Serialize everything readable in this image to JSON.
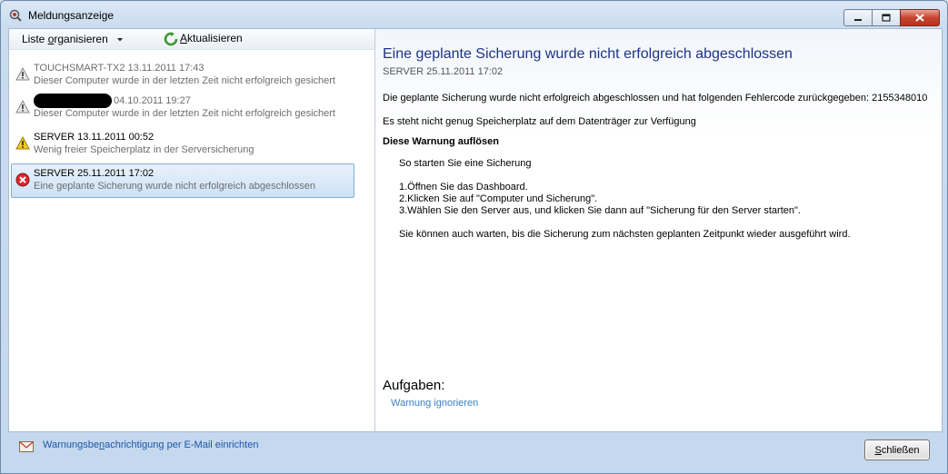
{
  "window": {
    "title": "Meldungsanzeige"
  },
  "toolbar": {
    "organize_pre": "Liste ",
    "organize_u": "o",
    "organize_post": "rganisieren",
    "refresh_u": "A",
    "refresh_post": "ktualisieren"
  },
  "alerts": [
    {
      "line1": "TOUCHSMART-TX2 13.11.2011 17:43",
      "line2": "Dieser Computer wurde in der letzten Zeit nicht erfolgreich gesichert",
      "severity": "info",
      "redacted": false
    },
    {
      "line1": "04.10.2011 19:27",
      "line2": "Dieser Computer wurde in der letzten Zeit nicht erfolgreich gesichert",
      "severity": "info",
      "redacted": true
    },
    {
      "line1": "SERVER 13.11.2011 00:52",
      "line2": "Wenig freier Speicherplatz in der Serversicherung",
      "severity": "warning",
      "redacted": false
    },
    {
      "line1": "SERVER 25.11.2011 17:02",
      "line2": "Eine geplante Sicherung wurde nicht erfolgreich abgeschlossen",
      "severity": "error",
      "redacted": false
    }
  ],
  "detail": {
    "title": "Eine geplante Sicherung wurde nicht erfolgreich abgeschlossen",
    "subtitle": "SERVER 25.11.2011 17:02",
    "para1": "Die geplante Sicherung wurde nicht erfolgreich abgeschlossen und hat folgenden Fehlercode zurückgegeben: 2155348010",
    "para2": "Es steht nicht genug Speicherplatz auf dem Datenträger zur Verfügung",
    "resolve_heading": "Diese Warnung auflösen",
    "howto": "So starten Sie eine Sicherung",
    "step1": "1.Öffnen Sie das Dashboard.",
    "step2": "2.Klicken Sie auf \"Computer und Sicherung\".",
    "step3": "3.Wählen Sie den Server aus, und klicken Sie dann auf \"Sicherung für den Server starten\".",
    "note": "Sie können auch warten, bis die Sicherung zum nächsten geplanten Zeitpunkt wieder ausgeführt wird.",
    "tasks_heading": "Aufgaben:",
    "task_ignore": "Warnung ignorieren"
  },
  "footer": {
    "mail_pre": "Warnungsbe",
    "mail_u": "n",
    "mail_post": "achrichtigung per E-Mail einrichten",
    "close_u": "S",
    "close_post": "chließen"
  },
  "colors": {
    "title_blue": "#1e3287",
    "link_blue": "#3a7fc1",
    "selection": "#cde2f7",
    "error_red": "#d8262b",
    "warning_yellow": "#f4cc1e"
  }
}
